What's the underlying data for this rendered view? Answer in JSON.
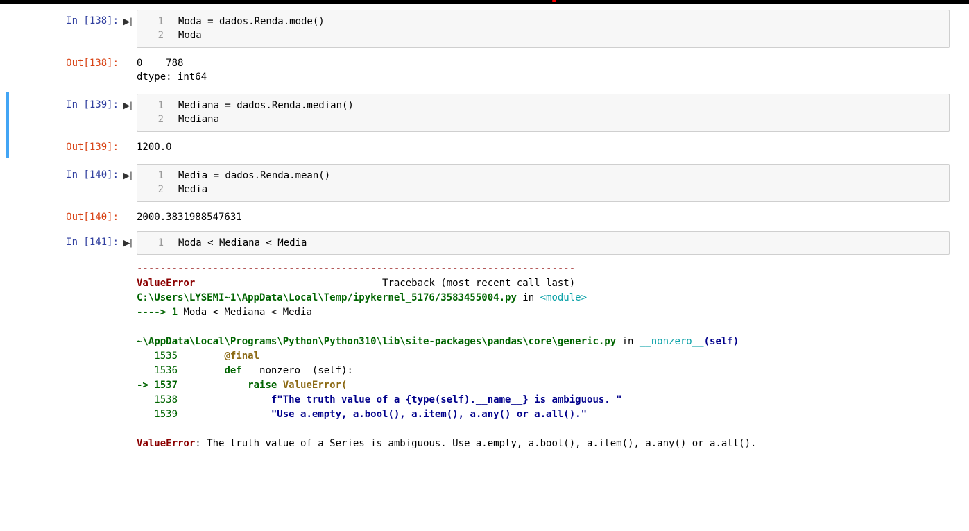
{
  "cells": [
    {
      "in_label": "In [138]:",
      "out_label": "Out[138]:",
      "lineno1": "1",
      "lineno2": "2",
      "code1": "Moda = dados.Renda.mode()",
      "code2": "Moda",
      "output": "0    788\ndtype: int64"
    },
    {
      "in_label": "In [139]:",
      "out_label": "Out[139]:",
      "lineno1": "1",
      "lineno2": "2",
      "code1": "Mediana = dados.Renda.median()",
      "code2": "Mediana",
      "output": "1200.0"
    },
    {
      "in_label": "In [140]:",
      "out_label": "Out[140]:",
      "lineno1": "1",
      "lineno2": "2",
      "code1": "Media = dados.Renda.mean()",
      "code2": "Media",
      "output": "2000.3831988547631"
    },
    {
      "in_label": "In [141]:",
      "lineno1": "1",
      "code1": "Moda < Mediana < Media"
    }
  ],
  "traceback": {
    "dashes": "---------------------------------------------------------------------------",
    "ename_left": "ValueError",
    "header_right": "Traceback (most recent call last)",
    "file1": "C:\\Users\\LYSEMI~1\\AppData\\Local\\Temp/ipykernel_5176/3583455004.py",
    "in_word": " in ",
    "module": "<module>",
    "arrow1": "----> 1 ",
    "arrow1_code": "Moda < Mediana < Media",
    "file2": "~\\AppData\\Local\\Programs\\Python\\Python310\\lib\\site-packages\\pandas\\core\\generic.py",
    "method": "__nonzero__",
    "self_arg": "(self)",
    "l1535_no": "   1535",
    "l1535_code": "        @final",
    "l1536_no": "   1536",
    "l1536_def": "        def ",
    "l1536_name": "__nonzero__",
    "l1536_args": "(self):",
    "l1537_arrow": "-> 1537",
    "l1537_raise": "            raise ",
    "l1537_err": "ValueError",
    "l1537_paren": "(",
    "l1538_no": "   1538",
    "l1538_str": "                f\"The truth value of a {type(self).__name__} is ambiguous. \"",
    "l1539_no": "   1539",
    "l1539_str": "                \"Use a.empty, a.bool(), a.item(), a.any() or a.all().\"",
    "final_ename": "ValueError",
    "final_msg": ": The truth value of a Series is ambiguous. Use a.empty, a.bool(), a.item(), a.any() or a.all()."
  }
}
